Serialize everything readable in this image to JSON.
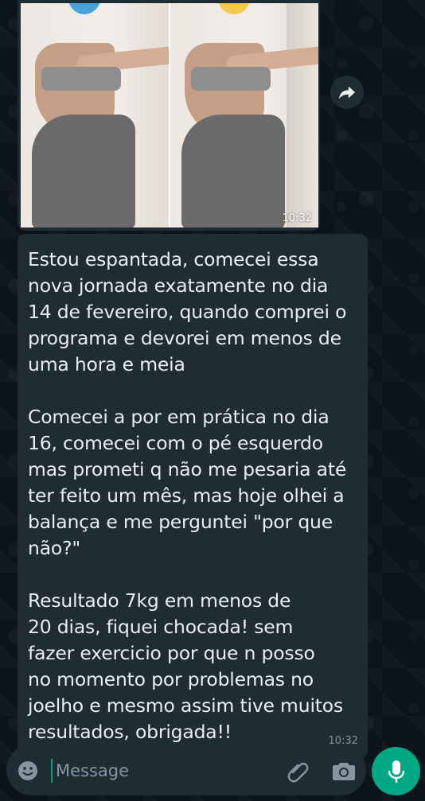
{
  "chat": {
    "image_message": {
      "time": "10:32"
    },
    "text_message": {
      "text": "Estou espantada, comecei essa\nnova jornada exatamente no dia\n14 de fevereiro, quando comprei o\nprograma e devorei em menos de\numa hora e meia\n\nComecei a por em prática no dia\n16, comecei com o pé esquerdo\nmas prometi q não me pesaria até\nter feito um mês, mas hoje olhei a\nbalança e me perguntei \"por que\nnão?\"\n\nResultado 7kg em menos de\n20 dias, fiquei chocada! sem\nfazer exercicio por que n posso\nno momento por problemas no\njoelho e mesmo assim tive muitos\nresultados, obrigada!!",
      "time": "10:32"
    }
  },
  "composer": {
    "placeholder": "Message"
  },
  "icons": {
    "forward": "forward-icon",
    "emoji": "emoji-icon",
    "attach": "paperclip-icon",
    "camera": "camera-icon",
    "mic": "microphone-icon"
  },
  "colors": {
    "background": "#0b141a",
    "bubble": "#202c33",
    "accent": "#00a884",
    "text": "#e9edef",
    "muted": "#8696a0"
  }
}
